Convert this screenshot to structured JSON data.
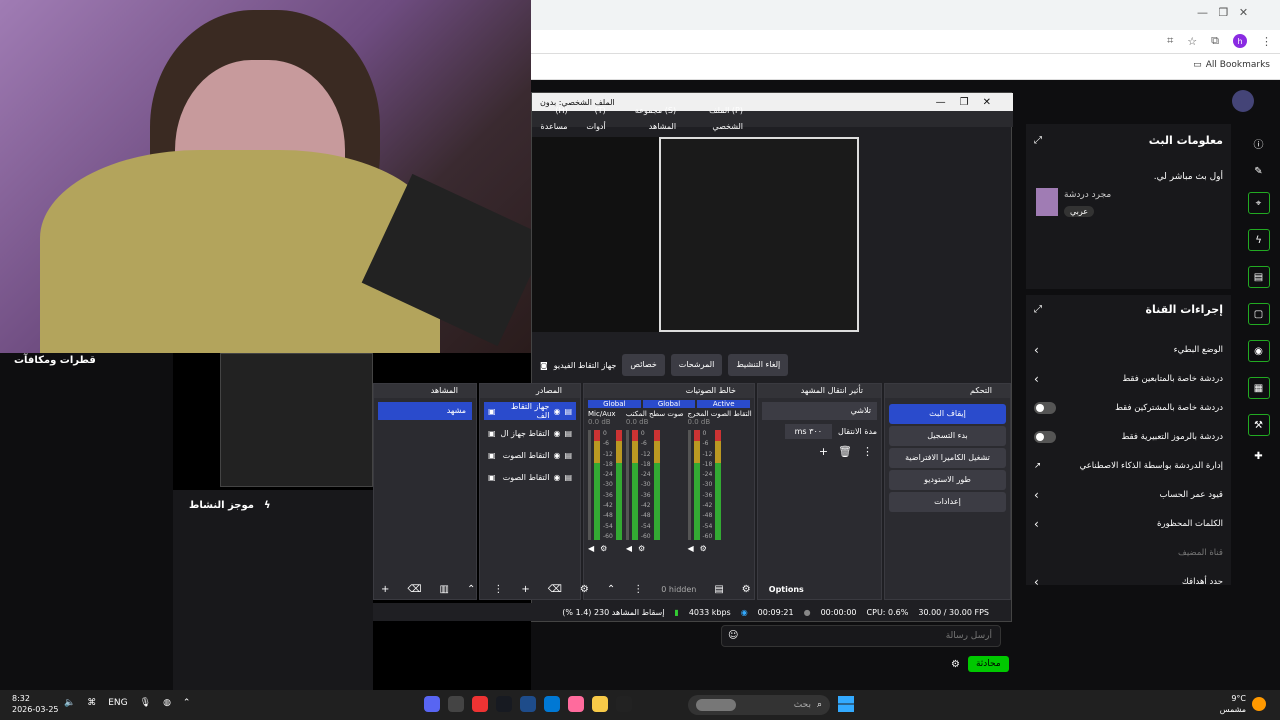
{
  "browser": {
    "bookmarks_label": "All Bookmarks",
    "profile_initial": "h"
  },
  "obs": {
    "title": "الملف الشخصي: بدون",
    "menu": [
      "(P) الملف الشخصي",
      "(S) مجموعة المشاهد",
      "(T) أدوات",
      "(H) مساعدة"
    ],
    "toolbar": {
      "source_name": "جهاز التقاط الفيديو",
      "properties": "خصائص",
      "filters": "المرشحات",
      "deactivate": "إلغاء التنشيط"
    },
    "docks": {
      "scenes": "المشاهد",
      "sources": "المصادر",
      "mixer": "خالط الصوتيات",
      "transitions": "تأثير انتقال المشهد",
      "controls": "التحكم"
    },
    "scenes": [
      "مشهد"
    ],
    "sources": [
      "جهاز التقاط الف",
      "التقاط جهاز ال",
      "التقاط الصوت",
      "التقاط الصوت"
    ],
    "mixer": {
      "tags": [
        "Global",
        "Global",
        "Active"
      ],
      "channels": [
        {
          "name": "Mic/Aux",
          "db": "0.0 dB"
        },
        {
          "name": "صوت سطح المكتب",
          "db": "0.0 dB"
        },
        {
          "name": "التقاط الصوت المخرج",
          "db": "0.0 dB"
        }
      ],
      "scale": [
        "0",
        "-6",
        "-12",
        "-18",
        "-24",
        "-30",
        "-36",
        "-42",
        "-48",
        "-54",
        "-60"
      ],
      "hidden": "0 hidden",
      "options": "Options"
    },
    "transitions": {
      "type": "تلاشي",
      "duration_label": "مدة الانتقال",
      "duration_value": "٣٠٠ ms"
    },
    "controls": [
      "إيقاف البث",
      "بدء التسجيل",
      "تشغيل الكاميرا الافتراضية",
      "طور الاستوديو",
      "إعدادات"
    ],
    "status": {
      "dropped": "إسقاط المشاهد 230 (1.4 %)",
      "bitrate": "4033 kbps",
      "live_time": "00:09:21",
      "rec_time": "00:00:00",
      "cpu": "CPU: 0.6%",
      "fps": "30.00 / 30.00 FPS"
    }
  },
  "twitch": {
    "stream_info": {
      "title": "معلومات البث",
      "stream_title": "أول بث مباشر لي.",
      "category": "مجرد دردشة",
      "tag": "عربي"
    },
    "channel_actions": {
      "title": "إجراءات القناة",
      "items": [
        {
          "label": "الوضع البطيء",
          "type": "arrow"
        },
        {
          "label": "دردشة خاصة بالمتابعين فقط",
          "type": "arrow"
        },
        {
          "label": "دردشة خاصة بالمشتركين فقط",
          "type": "toggle"
        },
        {
          "label": "دردشة بالرموز التعبيرية فقط",
          "type": "toggle"
        },
        {
          "label": "إدارة الدردشة بواسطة الذكاء الاصطناعي",
          "type": "link"
        },
        {
          "label": "قيود عمر الحساب",
          "type": "arrow"
        },
        {
          "label": "الكلمات المحظورة",
          "type": "arrow"
        },
        {
          "label": "قناة المضيف",
          "type": "dim"
        },
        {
          "label": "حدد أهدافك",
          "type": "arrow"
        }
      ]
    },
    "rewards_title": "قطرات ومكافآت",
    "activity_title": "موجز النشاط",
    "chat_placeholder": "أرسل رسالة",
    "chat_button": "محادثة"
  },
  "taskbar": {
    "time": "8:32",
    "date": "2026-03-25",
    "lang": "ENG",
    "search_placeholder": "بحث",
    "temp": "9°C",
    "weather": "مشمس"
  }
}
